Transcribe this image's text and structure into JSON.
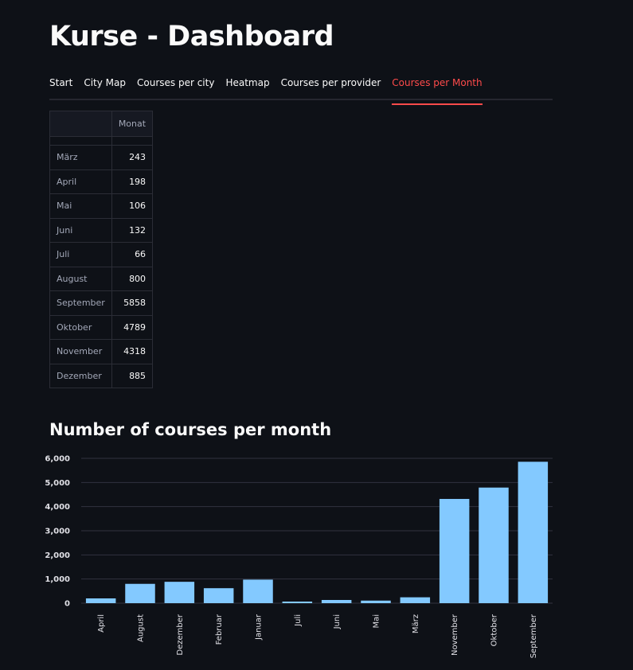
{
  "page": {
    "title": "Kurse - Dashboard"
  },
  "tabs": [
    {
      "label": "Start"
    },
    {
      "label": "City Map"
    },
    {
      "label": "Courses per city"
    },
    {
      "label": "Heatmap"
    },
    {
      "label": "Courses per provider"
    },
    {
      "label": "Courses per Month",
      "active": true
    }
  ],
  "table": {
    "column_header": "Monat",
    "rows": [
      {
        "label": "März",
        "value": "243"
      },
      {
        "label": "April",
        "value": "198"
      },
      {
        "label": "Mai",
        "value": "106"
      },
      {
        "label": "Juni",
        "value": "132"
      },
      {
        "label": "Juli",
        "value": "66"
      },
      {
        "label": "August",
        "value": "800"
      },
      {
        "label": "September",
        "value": "5858"
      },
      {
        "label": "Oktober",
        "value": "4789"
      },
      {
        "label": "November",
        "value": "4318"
      },
      {
        "label": "Dezember",
        "value": "885"
      }
    ]
  },
  "chart_section": {
    "title": "Number of courses per month"
  },
  "colors": {
    "background": "#0e1117",
    "accent": "#ff4b4b",
    "bar": "#83c9ff",
    "grid": "#31333f"
  },
  "chart_data": {
    "type": "bar",
    "categories": [
      "April",
      "August",
      "Dezember",
      "Februar",
      "Januar",
      "Juli",
      "Juni",
      "Mai",
      "März",
      "November",
      "Oktober",
      "September"
    ],
    "values": [
      198,
      800,
      885,
      620,
      975,
      66,
      132,
      106,
      243,
      4318,
      4789,
      5858
    ],
    "yticks": [
      0,
      1000,
      2000,
      3000,
      4000,
      5000,
      6000
    ],
    "ytick_labels": [
      "0",
      "1,000",
      "2,000",
      "3,000",
      "4,000",
      "5,000",
      "6,000"
    ],
    "ylim": [
      0,
      6000
    ],
    "grid": true,
    "legend": "none"
  }
}
